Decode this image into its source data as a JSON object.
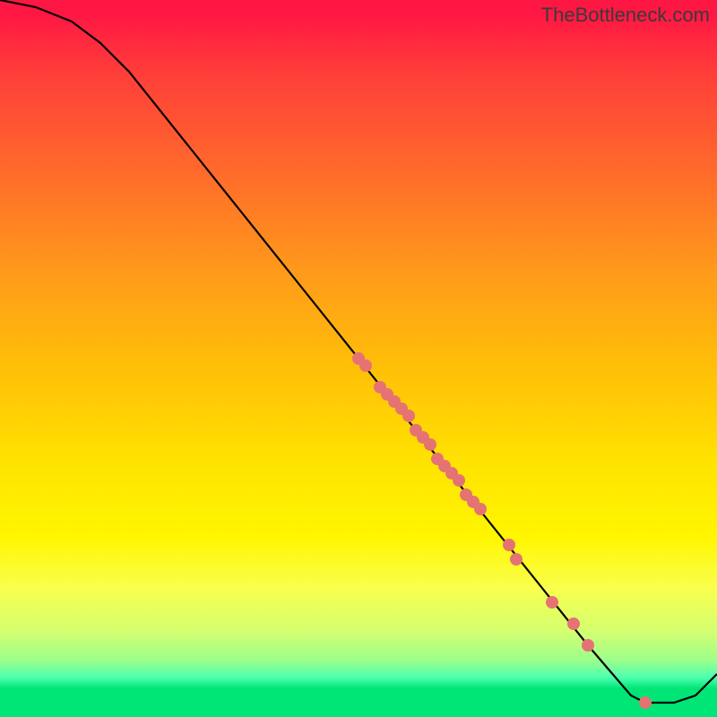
{
  "watermark": "TheBottleneck.com",
  "chart_data": {
    "type": "line",
    "title": "",
    "xlabel": "",
    "ylabel": "",
    "xlim": [
      0,
      100
    ],
    "ylim": [
      0,
      100
    ],
    "curve": [
      {
        "x": 0,
        "y": 100
      },
      {
        "x": 5,
        "y": 99
      },
      {
        "x": 10,
        "y": 97
      },
      {
        "x": 14,
        "y": 94
      },
      {
        "x": 18,
        "y": 90
      },
      {
        "x": 26,
        "y": 80
      },
      {
        "x": 34,
        "y": 70
      },
      {
        "x": 42,
        "y": 60
      },
      {
        "x": 50,
        "y": 50
      },
      {
        "x": 58,
        "y": 40
      },
      {
        "x": 66,
        "y": 30
      },
      {
        "x": 74,
        "y": 20
      },
      {
        "x": 82,
        "y": 10
      },
      {
        "x": 88,
        "y": 3
      },
      {
        "x": 90,
        "y": 2
      },
      {
        "x": 94,
        "y": 2
      },
      {
        "x": 97,
        "y": 3
      },
      {
        "x": 100,
        "y": 6
      }
    ],
    "points": [
      {
        "x": 50,
        "y": 50
      },
      {
        "x": 51,
        "y": 49
      },
      {
        "x": 53,
        "y": 46
      },
      {
        "x": 54,
        "y": 45
      },
      {
        "x": 55,
        "y": 44
      },
      {
        "x": 56,
        "y": 43
      },
      {
        "x": 57,
        "y": 42
      },
      {
        "x": 58,
        "y": 40
      },
      {
        "x": 59,
        "y": 39
      },
      {
        "x": 60,
        "y": 38
      },
      {
        "x": 61,
        "y": 36
      },
      {
        "x": 62,
        "y": 35
      },
      {
        "x": 63,
        "y": 34
      },
      {
        "x": 64,
        "y": 33
      },
      {
        "x": 65,
        "y": 31
      },
      {
        "x": 66,
        "y": 30
      },
      {
        "x": 67,
        "y": 29
      },
      {
        "x": 71,
        "y": 24
      },
      {
        "x": 72,
        "y": 22
      },
      {
        "x": 77,
        "y": 16
      },
      {
        "x": 80,
        "y": 13
      },
      {
        "x": 82,
        "y": 10
      },
      {
        "x": 90,
        "y": 2
      }
    ],
    "point_color": "#e57373",
    "line_color": "#000000",
    "gradient_stops": [
      {
        "pos": 0,
        "color": "#ff1744"
      },
      {
        "pos": 0.96,
        "color": "#00e676"
      }
    ]
  }
}
